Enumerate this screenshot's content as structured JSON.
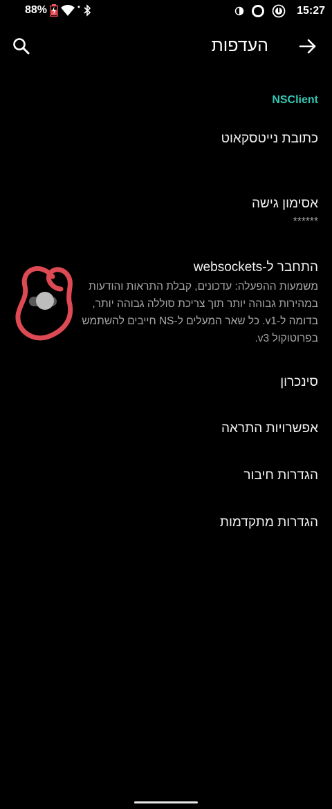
{
  "status_bar": {
    "battery_percent": "88%",
    "time": "15:27",
    "icons": [
      "battery-charging-icon",
      "wifi-icon",
      "bluetooth-icon",
      "data-saver-icon",
      "sync-ring-icon",
      "app-status-icon"
    ]
  },
  "app_bar": {
    "title": "העדפות",
    "search_icon": "search-icon",
    "back_icon": "arrow-forward-icon"
  },
  "section": {
    "header": "NSClient"
  },
  "prefs": {
    "ns_url_title": "כתובת נייטסקאוט",
    "access_token_title": "אסימון גישה",
    "access_token_summary": "******",
    "websockets_title": "התחבר ל-websockets",
    "websockets_summary": "משמעות ההפעלה: עדכונים, קבלת התראות והודעות במהירות גבוהה יותר תוך צריכת סוללה גבוהה יותר, בדומה ל-v1. כל שאר המעלים ל-NS חייבים להשתמש בפרוטוקול v3.",
    "websockets_enabled": false,
    "sync_title": "סינכרון",
    "alarm_options_title": "אפשרויות התראה",
    "connection_settings_title": "הגדרות חיבור",
    "advanced_settings_title": "הגדרות מתקדמות"
  },
  "colors": {
    "background": "#000000",
    "accent": "#35c7b5",
    "annotation": "#f0505a",
    "toggle_thumb": "#bdbdbd",
    "toggle_track": "#5a5a5a"
  }
}
